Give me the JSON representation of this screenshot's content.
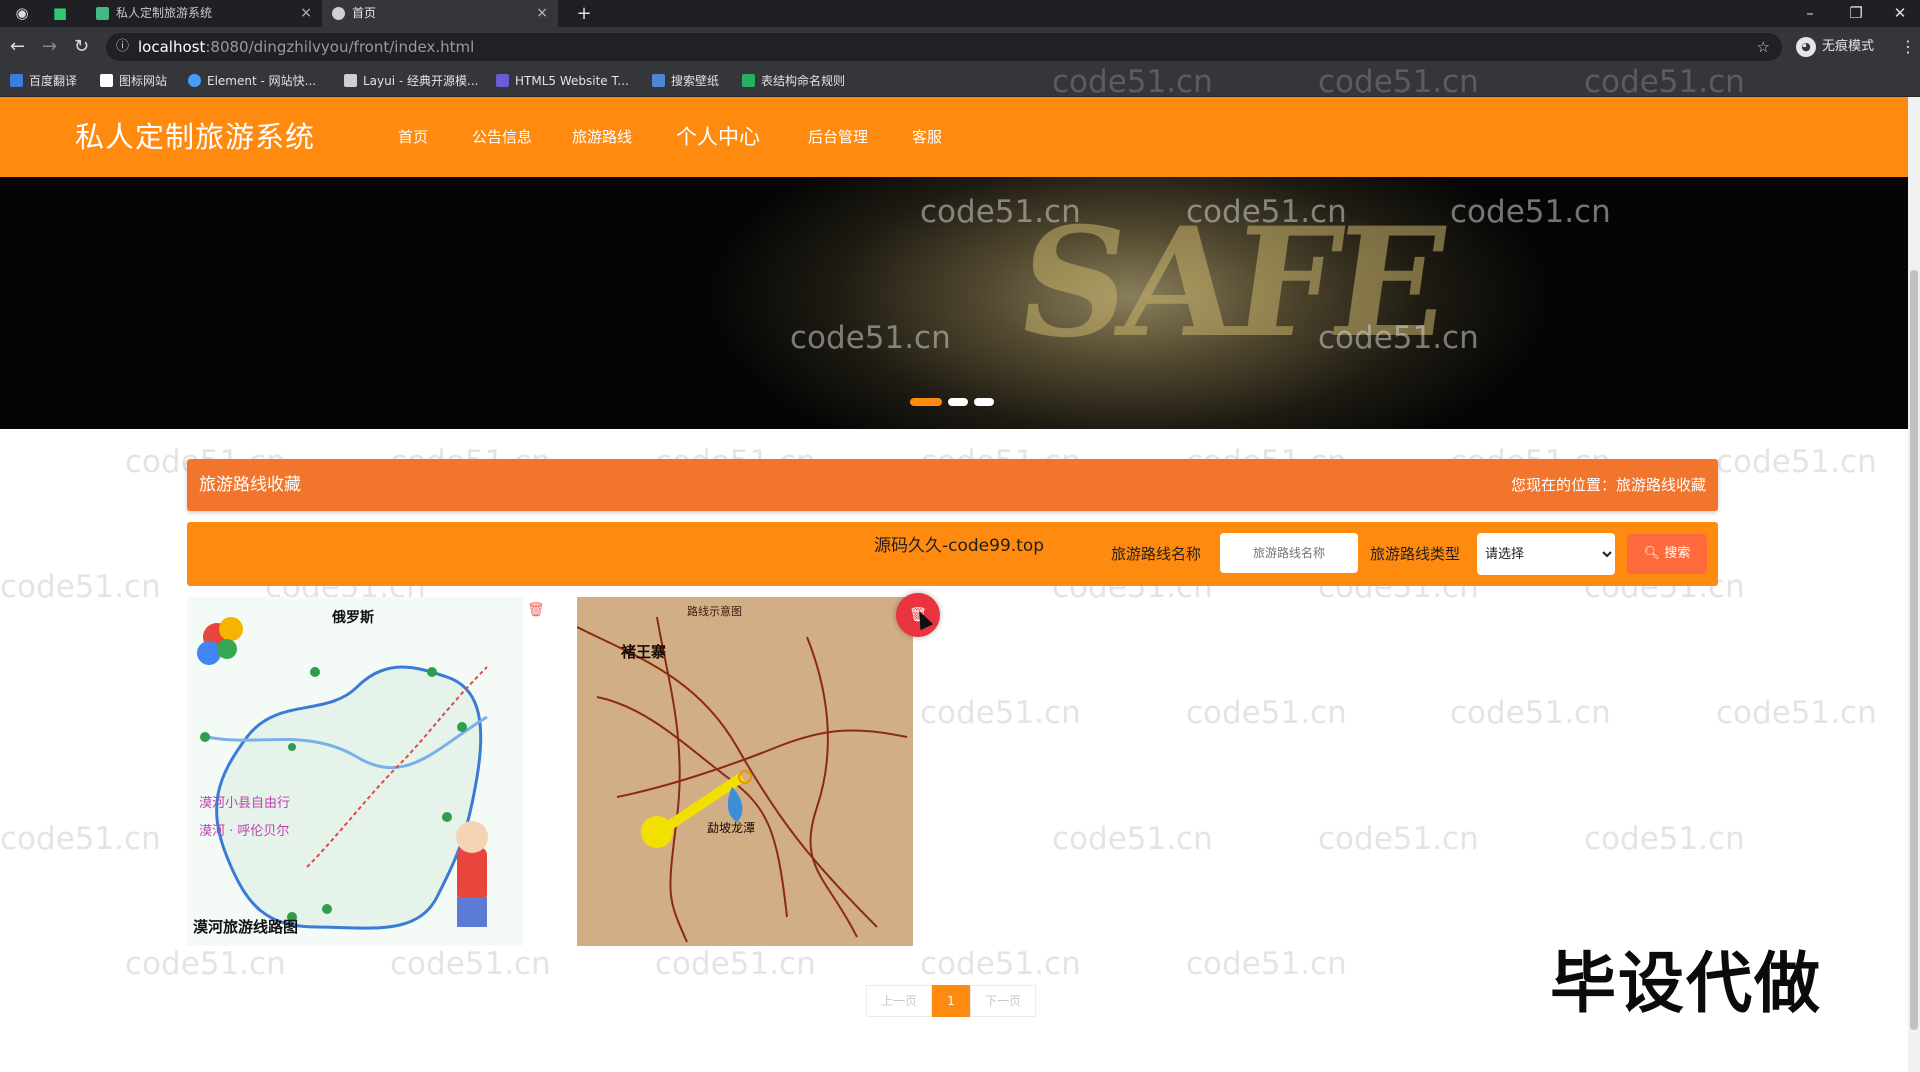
{
  "browser": {
    "tabs": [
      {
        "title": "私人定制旅游系统",
        "active": false
      },
      {
        "title": "首页",
        "active": true
      }
    ],
    "url_host": "localhost",
    "url_rest": ":8080/dingzhilvyou/front/index.html",
    "incognito_label": "无痕模式",
    "bookmarks": [
      "百度翻译",
      "图标网站",
      "Element - 网站快...",
      "Layui - 经典开源模...",
      "HTML5 Website T...",
      "搜索壁纸",
      "表结构命名规则"
    ]
  },
  "site": {
    "title": "私人定制旅游系统",
    "nav": [
      "首页",
      "公告信息",
      "旅游路线",
      "个人中心",
      "后台管理",
      "客服"
    ]
  },
  "banner": {
    "word": "SAFE",
    "slide_count": 3,
    "active_slide": 1
  },
  "page": {
    "heading": "旅游路线收藏",
    "location": "您现在的位置：旅游路线收藏"
  },
  "search": {
    "ad_text": "源码久久-code99.top",
    "name_label": "旅游路线名称",
    "name_placeholder": "旅游路线名称",
    "type_label": "旅游路线类型",
    "type_selected": "请选择",
    "button_label": "搜索"
  },
  "cards": [
    {
      "map_title": "俄罗斯",
      "caption": "漠河旅游线路图",
      "side_text": [
        "漠河小县自由行",
        "漠河 · 呼伦贝尔"
      ]
    },
    {
      "map_title": "路线示意图",
      "caption": "褚王寨",
      "place": "勐坡龙潭"
    }
  ],
  "pagination": {
    "prev": "上一页",
    "current": "1",
    "next": "下一页"
  },
  "watermark": "code51.cn",
  "overlay": "毕设代做",
  "colors": {
    "brand": "#ff8a10",
    "title_bar": "#f2752e",
    "search_button": "#ff6a3d",
    "delete": "#e9343f"
  }
}
